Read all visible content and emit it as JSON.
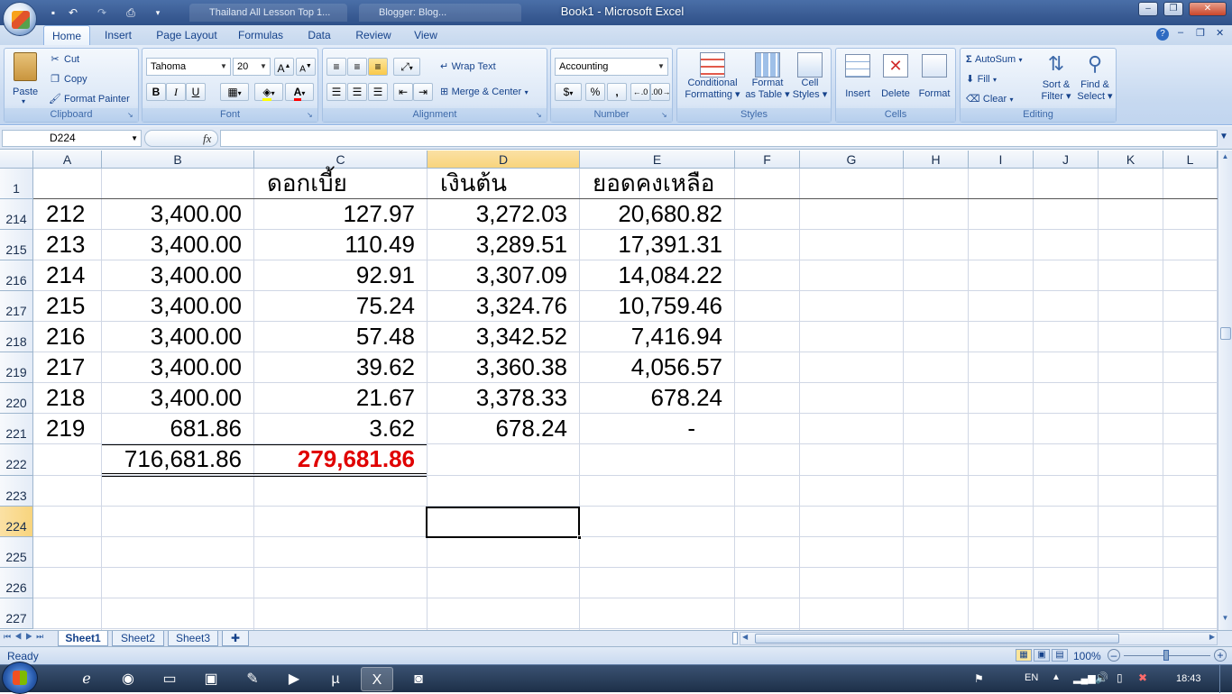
{
  "app": {
    "window_title": "Book1 - Microsoft Excel",
    "ghost_tabs": [
      "Thailand All Lesson Top 1...",
      "Blogger: Blog..."
    ]
  },
  "ribbon_tabs": [
    "Home",
    "Insert",
    "Page Layout",
    "Formulas",
    "Data",
    "Review",
    "View"
  ],
  "clipboard": {
    "paste": "Paste",
    "cut": "Cut",
    "copy": "Copy",
    "format_painter": "Format Painter",
    "label": "Clipboard"
  },
  "font": {
    "name": "Tahoma",
    "size": "20",
    "label": "Font",
    "bold": "B",
    "italic": "I",
    "underline": "U"
  },
  "alignment": {
    "wrap_text": "Wrap Text",
    "merge_center": "Merge & Center",
    "label": "Alignment"
  },
  "number": {
    "format": "Accounting",
    "percent": "%",
    "comma": ",",
    "label": "Number"
  },
  "styles": {
    "conditional": "Conditional",
    "formatting": "Formatting",
    "format": "Format",
    "as_table": "as Table",
    "cell": "Cell",
    "cell_styles": "Styles",
    "label": "Styles"
  },
  "cells": {
    "insert": "Insert",
    "delete": "Delete",
    "format": "Format",
    "label": "Cells"
  },
  "editing": {
    "autosum": "AutoSum",
    "fill": "Fill",
    "clear": "Clear",
    "sort": "Sort &",
    "filter": "Filter",
    "find": "Find &",
    "select": "Select",
    "label": "Editing"
  },
  "formula_bar": {
    "name_box": "D224",
    "fx": "fx",
    "formula": ""
  },
  "columns": [
    "A",
    "B",
    "C",
    "D",
    "E",
    "F",
    "G",
    "H",
    "I",
    "J",
    "K",
    "L"
  ],
  "header_row": {
    "row": "1",
    "C": "ดอกเบี้ย",
    "D": "เงินต้น",
    "E": "ยอดคงเหลือ"
  },
  "rows": [
    {
      "row": "214",
      "A": "212",
      "B": "3,400.00",
      "C": "127.97",
      "D": "3,272.03",
      "E": "20,680.82"
    },
    {
      "row": "215",
      "A": "213",
      "B": "3,400.00",
      "C": "110.49",
      "D": "3,289.51",
      "E": "17,391.31"
    },
    {
      "row": "216",
      "A": "214",
      "B": "3,400.00",
      "C": "92.91",
      "D": "3,307.09",
      "E": "14,084.22"
    },
    {
      "row": "217",
      "A": "215",
      "B": "3,400.00",
      "C": "75.24",
      "D": "3,324.76",
      "E": "10,759.46"
    },
    {
      "row": "218",
      "A": "216",
      "B": "3,400.00",
      "C": "57.48",
      "D": "3,342.52",
      "E": "7,416.94"
    },
    {
      "row": "219",
      "A": "217",
      "B": "3,400.00",
      "C": "39.62",
      "D": "3,360.38",
      "E": "4,056.57"
    },
    {
      "row": "220",
      "A": "218",
      "B": "3,400.00",
      "C": "21.67",
      "D": "3,378.33",
      "E": "678.24"
    },
    {
      "row": "221",
      "A": "219",
      "B": "681.86",
      "C": "3.62",
      "D": "678.24",
      "E": "-"
    }
  ],
  "totals": {
    "row": "222",
    "B": "716,681.86",
    "C": "279,681.86"
  },
  "empty_rows": [
    "223",
    "224",
    "225",
    "226",
    "227"
  ],
  "sheets": [
    "Sheet1",
    "Sheet2",
    "Sheet3"
  ],
  "status": {
    "ready": "Ready",
    "zoom": "100%"
  },
  "taskbar": {
    "lang": "EN",
    "time": "18:43"
  },
  "colors": {
    "accent_red": "#e00000",
    "selection_header": "#f8d47d"
  }
}
